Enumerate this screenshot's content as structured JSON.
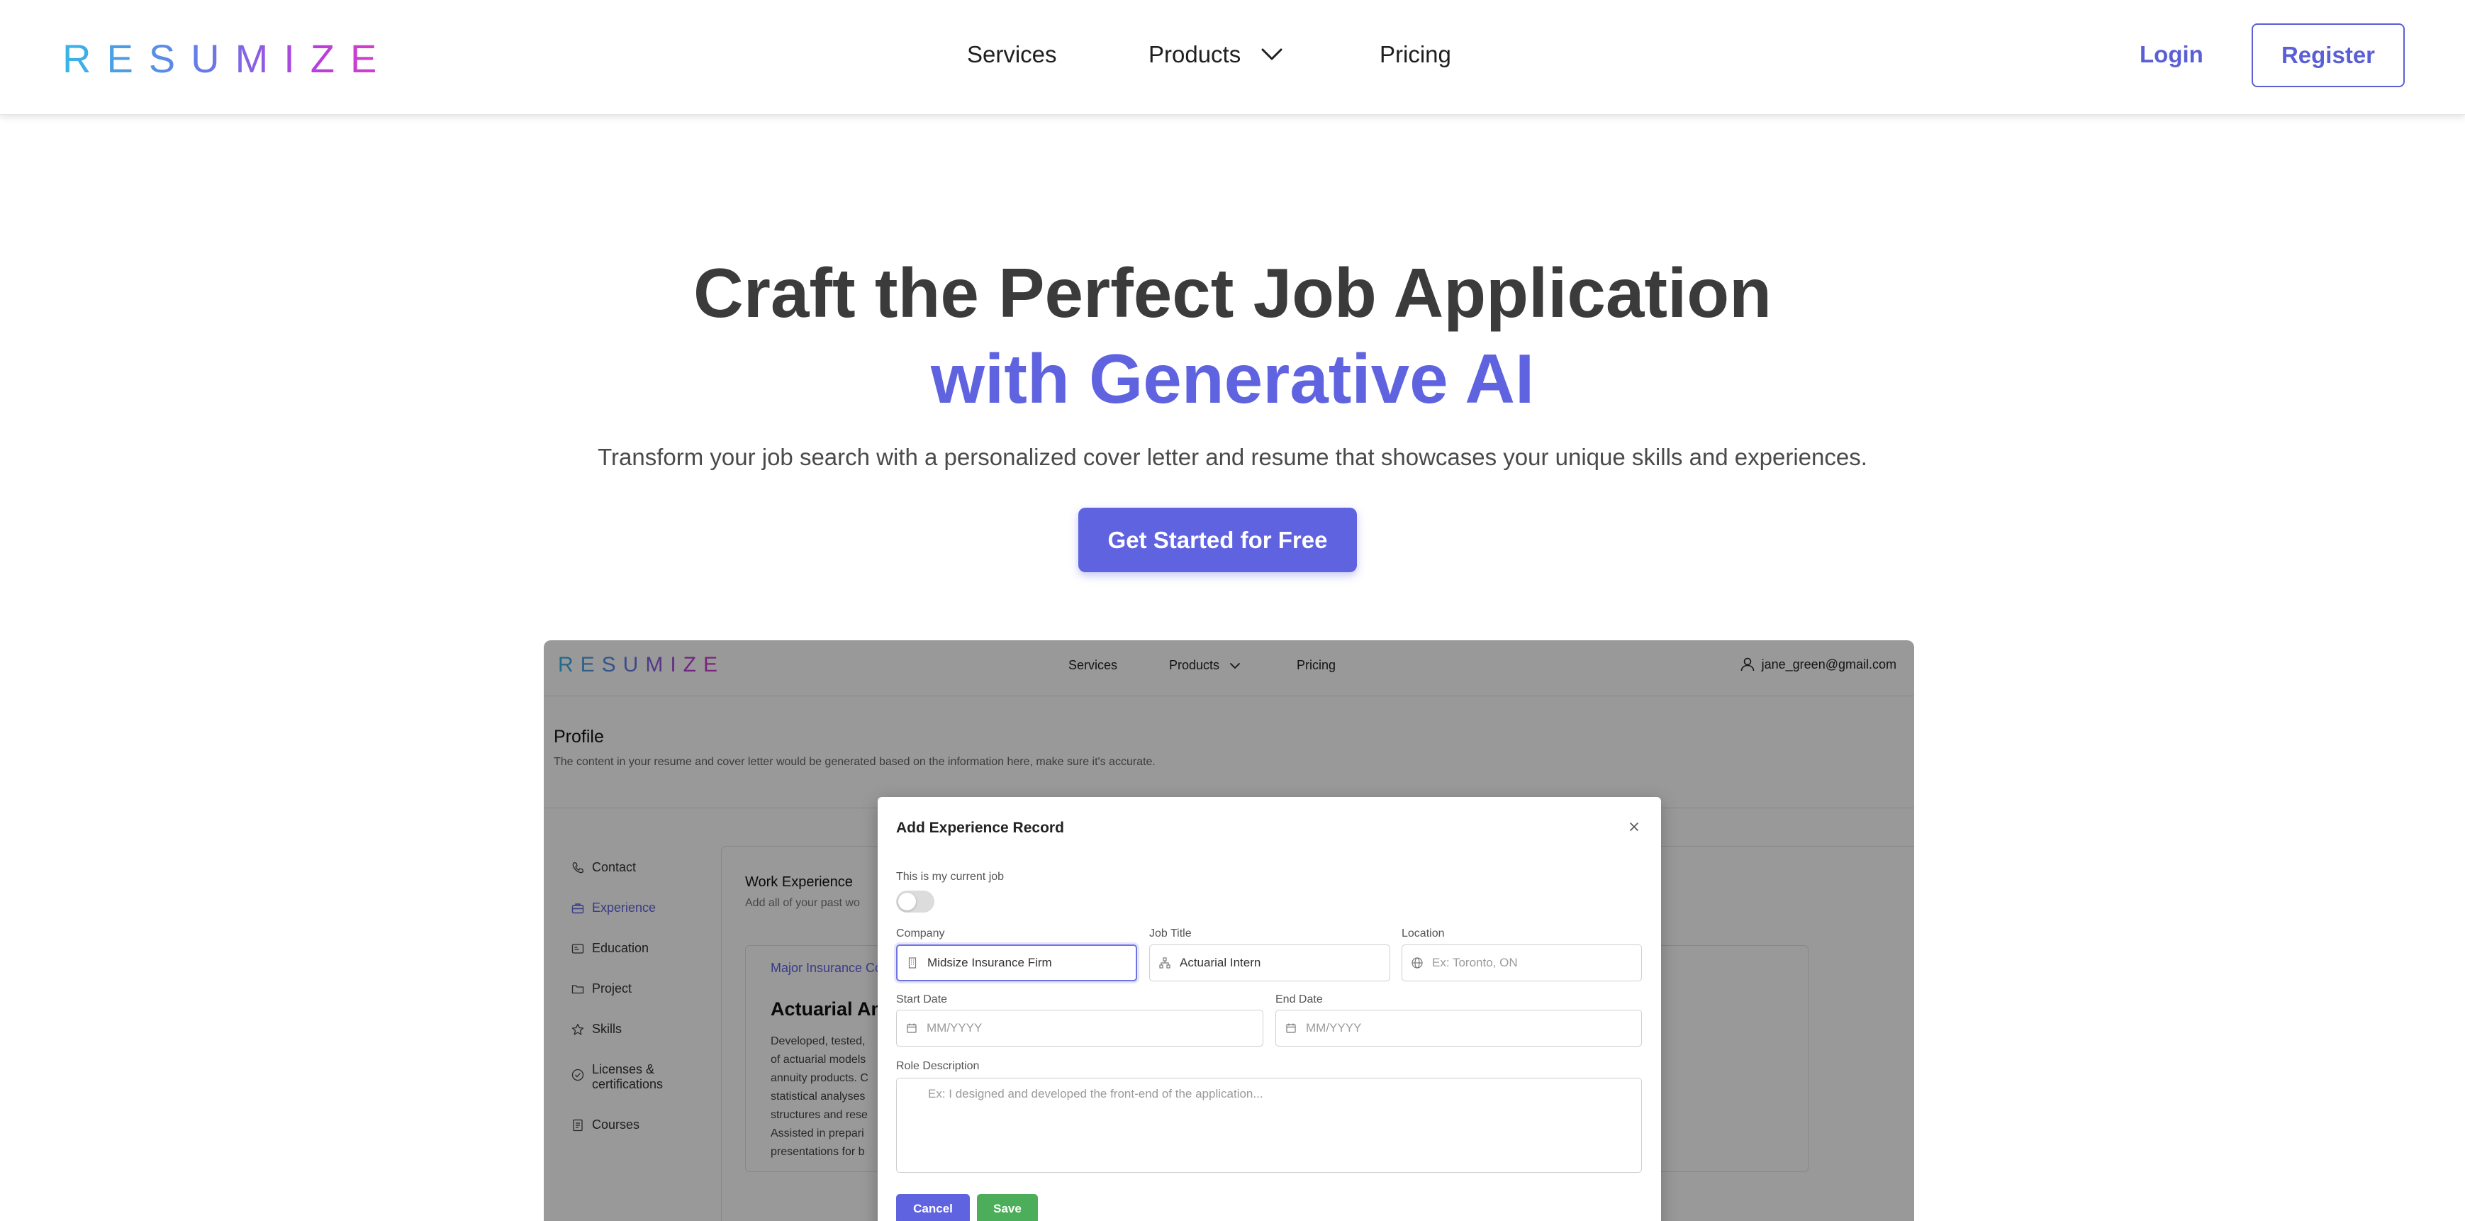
{
  "header": {
    "logo_text": "RESUMIZE",
    "nav": {
      "services": "Services",
      "products": "Products",
      "pricing": "Pricing"
    },
    "login": "Login",
    "register": "Register"
  },
  "hero": {
    "title_line1": "Craft the Perfect Job Application",
    "title_line2": "with Generative AI",
    "subtitle": "Transform your job search with a personalized cover letter and resume that showcases your unique skills and experiences.",
    "cta": "Get Started for Free"
  },
  "preview": {
    "logo_text": "RESUMIZE",
    "nav": {
      "services": "Services",
      "products": "Products",
      "pricing": "Pricing"
    },
    "user_email": "jane_green@gmail.com",
    "profile_title": "Profile",
    "profile_desc": "The content in your resume and cover letter would be generated based on the information here, make sure it's accurate.",
    "sidebar": [
      {
        "label": "Contact",
        "icon": "phone-icon"
      },
      {
        "label": "Experience",
        "icon": "briefcase-icon",
        "active": true
      },
      {
        "label": "Education",
        "icon": "id-card-icon"
      },
      {
        "label": "Project",
        "icon": "folder-icon"
      },
      {
        "label": "Skills",
        "icon": "star-icon"
      },
      {
        "label": "Licenses & certifications",
        "icon": "check-circle-icon"
      },
      {
        "label": "Courses",
        "icon": "document-icon"
      }
    ],
    "work_experience": {
      "title": "Work Experience",
      "subtitle": "Add all of your past wo",
      "company": "Major Insurance Co",
      "role": "Actuarial An",
      "description": "Developed, tested, of actuarial models annuity products. C statistical analyses structures and rese Assisted in prepari presentations for b"
    },
    "modal": {
      "title": "Add Experience Record",
      "current_job_label": "This is my current job",
      "current_job_on": false,
      "company_label": "Company",
      "company_value": "Midsize Insurance Firm",
      "job_title_label": "Job Title",
      "job_title_value": "Actuarial Intern",
      "location_label": "Location",
      "location_placeholder": "Ex: Toronto, ON",
      "start_date_label": "Start Date",
      "start_date_placeholder": "MM/YYYY",
      "end_date_label": "End Date",
      "end_date_placeholder": "MM/YYYY",
      "role_description_label": "Role Description",
      "role_description_placeholder": "Ex: I designed and developed the front-end of the application...",
      "cancel": "Cancel",
      "save": "Save"
    }
  },
  "colors": {
    "accent": "#5f63e0",
    "save_green": "#4cae5a",
    "heading": "#3b3b3b"
  }
}
